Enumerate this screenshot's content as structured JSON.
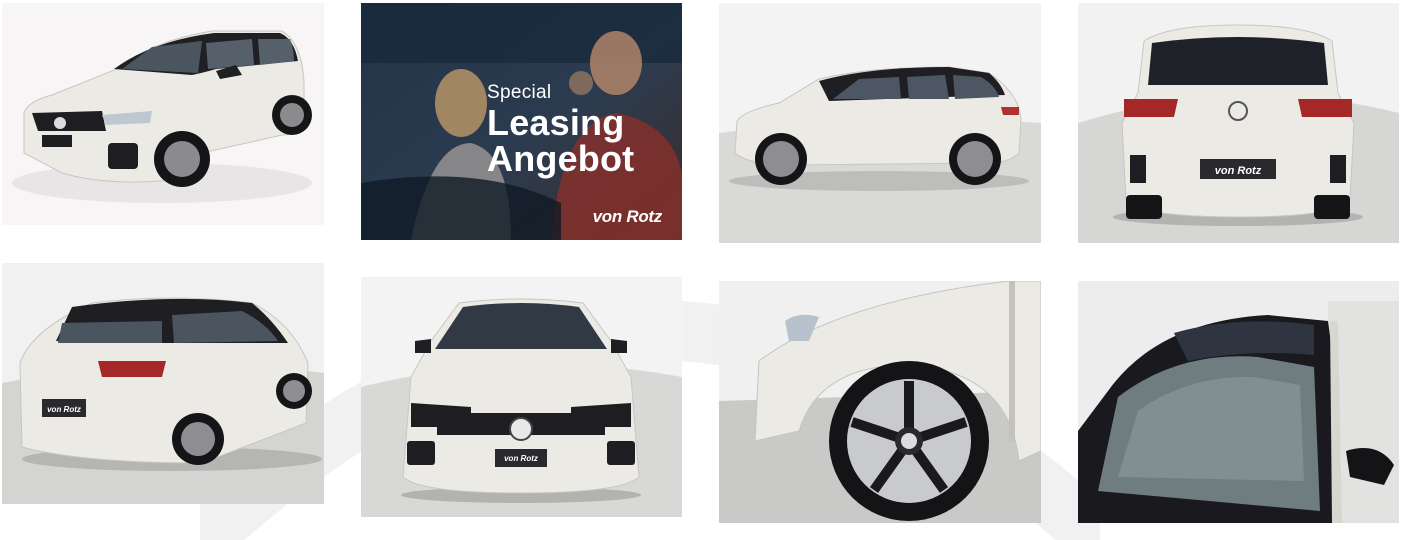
{
  "gallery": {
    "promo": {
      "line1": "Special",
      "line2": "Leasing",
      "line3": "Angebot",
      "logo": "von Rotz"
    },
    "plate_text": "von Rotz",
    "photos": [
      {
        "view": "front-left-three-quarter"
      },
      {
        "view": "promo-banner"
      },
      {
        "view": "side-profile"
      },
      {
        "view": "rear"
      },
      {
        "view": "rear-left-three-quarter"
      },
      {
        "view": "front"
      },
      {
        "view": "wheel-detail"
      },
      {
        "view": "panoramic-roof-detail"
      }
    ]
  },
  "colors": {
    "car_body": "#eceae4",
    "car_roof": "#1d1d20",
    "studio_floor": "#d8d8d6",
    "promo_overlay": "#1f2f44"
  }
}
